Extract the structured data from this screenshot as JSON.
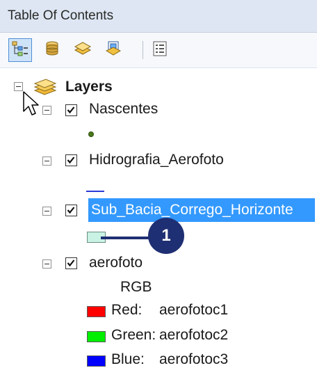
{
  "window": {
    "title": "Table Of Contents"
  },
  "toolbar": {
    "buttons": [
      {
        "name": "list-by-drawing-order",
        "icon": "list-by-drawing-order-icon",
        "active": true
      },
      {
        "name": "list-by-source",
        "icon": "database-icon",
        "active": false
      },
      {
        "name": "list-by-visibility",
        "icon": "layers-visibility-icon",
        "active": false
      },
      {
        "name": "list-by-selection",
        "icon": "selection-icon",
        "active": false
      },
      {
        "name": "options",
        "icon": "options-icon",
        "active": false
      }
    ]
  },
  "toc": {
    "root_label": "Layers",
    "layers": [
      {
        "label": "Nascentes",
        "checked": true,
        "legend": "point",
        "legend_color": "#4a7a1c"
      },
      {
        "label": "Hidrografia_Aerofoto",
        "checked": true,
        "legend": "line",
        "legend_color": "#2b3bd6"
      },
      {
        "label": "Sub_Bacia_Corrego_Horizonte",
        "checked": true,
        "selected": true,
        "legend": "polygon",
        "legend_color": "#c9f2e4"
      },
      {
        "label": "aerofoto",
        "checked": true,
        "legend": "rgb",
        "rgb_label": "RGB",
        "bands": [
          {
            "channel": "Red:",
            "band": "aerofotoc1",
            "color": "#ff0000"
          },
          {
            "channel": "Green:",
            "band": "aerofotoc2",
            "color": "#00ee00"
          },
          {
            "channel": "Blue:",
            "band": "aerofotoc3",
            "color": "#0000ff"
          }
        ]
      }
    ]
  },
  "callout": {
    "number": "1",
    "color": "#1f2f73"
  },
  "colors": {
    "selection": "#3399ff",
    "title_bar": "#dde6f2"
  }
}
